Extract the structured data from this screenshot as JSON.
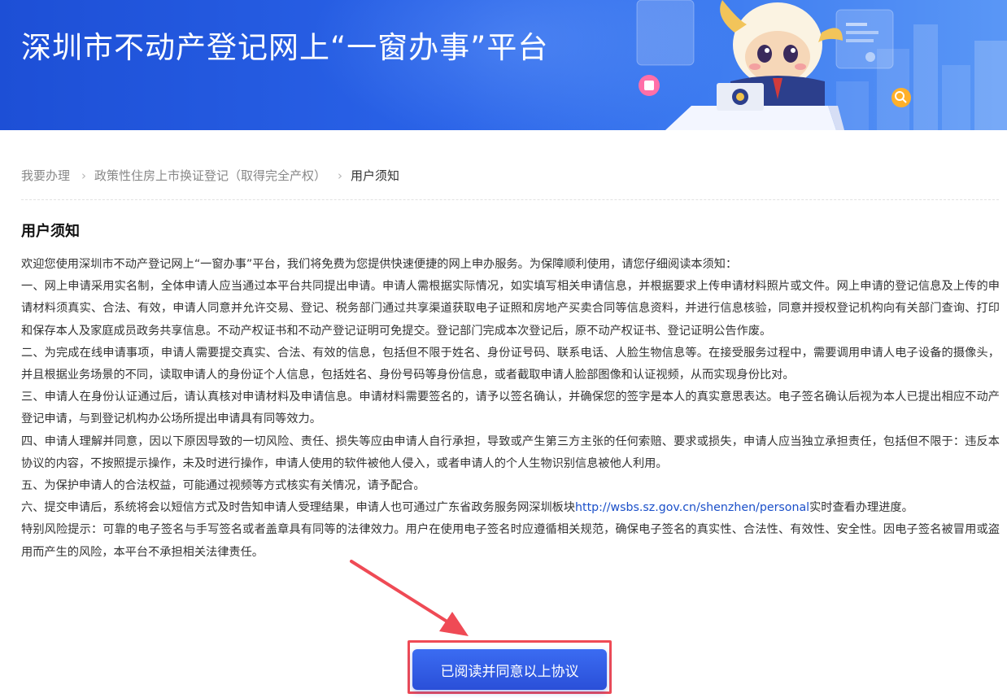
{
  "banner": {
    "title": "深圳市不动产登记网上“一窗办事”平台"
  },
  "breadcrumb": {
    "items": [
      "我要办理",
      "政策性住房上市换证登记（取得完全产权）",
      "用户须知"
    ]
  },
  "notice": {
    "heading": "用户须知",
    "intro": "欢迎您使用深圳市不动产登记网上“一窗办事”平台，我们将免费为您提供快速便捷的网上申办服务。为保障顺利使用，请您仔细阅读本须知：",
    "item1": "一、网上申请采用实名制，全体申请人应当通过本平台共同提出申请。申请人需根据实际情况，如实填写相关申请信息，并根据要求上传申请材料照片或文件。网上申请的登记信息及上传的申请材料须真实、合法、有效，申请人同意并允许交易、登记、税务部门通过共享渠道获取电子证照和房地产买卖合同等信息资料，并进行信息核验，同意并授权登记机构向有关部门查询、打印和保存本人及家庭成员政务共享信息。不动产权证书和不动产登记证明可免提交。登记部门完成本次登记后，原不动产权证书、登记证明公告作废。",
    "item2": "二、为完成在线申请事项，申请人需要提交真实、合法、有效的信息，包括但不限于姓名、身份证号码、联系电话、人脸生物信息等。在接受服务过程中，需要调用申请人电子设备的摄像头，并且根据业务场景的不同，读取申请人的身份证个人信息，包括姓名、身份号码等身份信息，或者截取申请人脸部图像和认证视频，从而实现身份比对。",
    "item3": "三、申请人在身份认证通过后，请认真核对申请材料及申请信息。申请材料需要签名的，请予以签名确认，并确保您的签字是本人的真实意思表达。电子签名确认后视为本人已提出相应不动产登记申请，与到登记机构办公场所提出申请具有同等效力。",
    "item4": "四、申请人理解并同意，因以下原因导致的一切风险、责任、损失等应由申请人自行承担，导致或产生第三方主张的任何索赔、要求或损失，申请人应当独立承担责任，包括但不限于：违反本协议的内容，不按照提示操作，未及时进行操作，申请人使用的软件被他人侵入，或者申请人的个人生物识别信息被他人利用。",
    "item5": "五、为保护申请人的合法权益，可能通过视频等方式核实有关情况，请予配合。",
    "item6_prefix": "六、提交申请后，系统将会以短信方式及时告知申请人受理结果，申请人也可通过广东省政务服务网深圳板块",
    "item6_link": "http://wsbs.sz.gov.cn/shenzhen/personal",
    "item6_suffix": "实时查看办理进度。",
    "risk": "特别风险提示：可靠的电子签名与手写签名或者盖章具有同等的法律效力。用户在使用电子签名时应遵循相关规范，确保电子签名的真实性、合法性、有效性、安全性。因电子签名被冒用或盗用而产生的风险，本平台不承担相关法律责任。"
  },
  "agree_button": {
    "label": "已阅读并同意以上协议"
  },
  "colors": {
    "banner": "#2a63e8",
    "button": "#2f5ce6",
    "highlight": "#ef4a55",
    "link": "#1a4fc9"
  }
}
